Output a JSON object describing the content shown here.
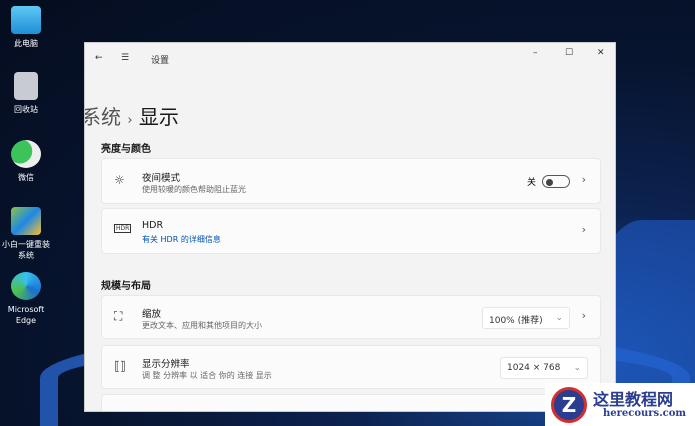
{
  "desktop": {
    "icons": [
      {
        "label": "此电脑"
      },
      {
        "label": "回收站"
      },
      {
        "label": "微信"
      },
      {
        "label": "小白一键重装系统"
      },
      {
        "label": "Microsoft Edge"
      }
    ]
  },
  "window": {
    "title": "设置",
    "breadcrumb_parent": "系统",
    "breadcrumb_sep": "›",
    "breadcrumb_current": "显示"
  },
  "sections": [
    {
      "title": "亮度与颜色",
      "items": [
        {
          "icon": "sun-icon",
          "title": "夜间模式",
          "subtitle": "使用较暖的颜色帮助阻止蓝光",
          "toggle_label": "关",
          "toggle_on": false
        },
        {
          "icon": "hdr-icon",
          "title": "HDR",
          "link": "有关 HDR 的详细信息"
        }
      ]
    },
    {
      "title": "规模与布局",
      "items": [
        {
          "icon": "scale-icon",
          "title": "缩放",
          "subtitle": "更改文本、应用和其他项目的大小",
          "value": "100% (推荐)"
        },
        {
          "icon": "resolution-icon",
          "title": "显示分辨率",
          "subtitle": "调 整 分辨率 以 适合 你的 连接 显示",
          "value": "1024 × 768"
        }
      ]
    }
  ],
  "watermark": {
    "name": "这里教程网",
    "url": "herecours.com"
  },
  "colors": {
    "link": "#0050b3",
    "accent": "#2d6fe0"
  }
}
